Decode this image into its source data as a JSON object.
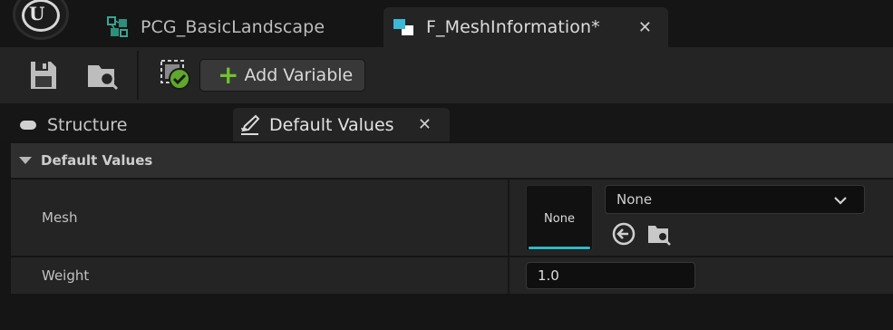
{
  "document_tabs": [
    {
      "label": "PCG_BasicLandscape",
      "icon": "landscape-graph-icon",
      "active": false
    },
    {
      "label": "F_MeshInformation*",
      "icon": "struct-asset-icon",
      "active": true
    }
  ],
  "toolbar": {
    "save_icon": "save-icon",
    "browse_icon": "browse-folder-icon",
    "compile_icon": "status-ok-icon",
    "add_variable_label": "Add Variable"
  },
  "panel_tabs": [
    {
      "label": "Structure",
      "active": false
    },
    {
      "label": "Default Values",
      "active": true
    }
  ],
  "details": {
    "category": "Default Values",
    "rows": [
      {
        "name": "Mesh",
        "thumbnail_label": "None",
        "selected_value": "None"
      },
      {
        "name": "Weight",
        "value": "1.0"
      }
    ]
  },
  "colors": {
    "accent_cyan": "#2fb8c8",
    "add_green": "#6ec42b",
    "panel_bg": "#242424",
    "window_bg": "#151515"
  }
}
